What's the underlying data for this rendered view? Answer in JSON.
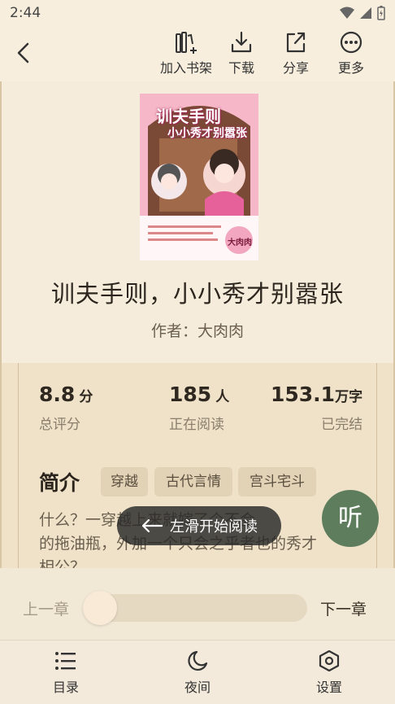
{
  "status_bar": {
    "time": "2:44"
  },
  "toolbar": {
    "add_shelf": "加入书架",
    "download": "下载",
    "share": "分享",
    "more": "更多"
  },
  "book": {
    "title": "训夫手则，小小秀才别嚣张",
    "author": "作者：大肉肉",
    "cover_title_1": "训夫手则",
    "cover_title_2": "小小秀才别嚣张",
    "cover_author": "大肉肉"
  },
  "stats": [
    {
      "value": "8.8",
      "unit": "分",
      "label": "总评分"
    },
    {
      "value": "185",
      "unit": "人",
      "label": "正在阅读"
    },
    {
      "value": "153.1",
      "unit": "万字",
      "label": "已完结"
    }
  ],
  "intro": {
    "heading": "简介",
    "tags": [
      "穿越",
      "古代言情",
      "宫斗宅斗"
    ],
    "text_line1": "什么？一穿越上来就嫁了个不会",
    "text_line2": "的拖油瓶，外加一个只会之乎者也的秀才",
    "text_line3": "相公？"
  },
  "overlay": {
    "swipe_hint": "左滑开始阅读",
    "listen": "听"
  },
  "chapter": {
    "prev": "上一章",
    "next": "下一章",
    "progress": 0
  },
  "bottom_nav": {
    "toc": "目录",
    "night": "夜间",
    "settings": "设置"
  },
  "colors": {
    "listen_button": "#5d7d5d",
    "page_background": "#f4ead7"
  }
}
